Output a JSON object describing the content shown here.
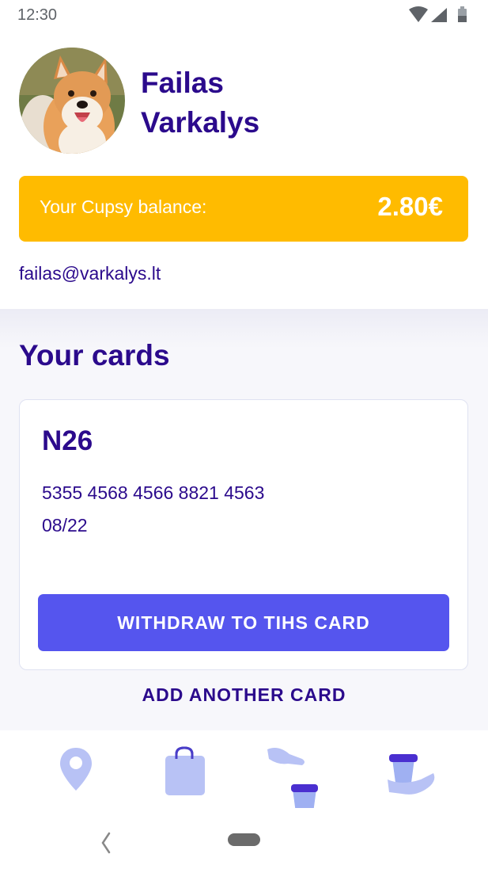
{
  "status_bar": {
    "time": "12:30",
    "icons": [
      "wifi-icon",
      "signal-icon",
      "battery-icon"
    ]
  },
  "profile": {
    "first_name": "Failas",
    "last_name": "Varkalys",
    "avatar": "shiba-inu-dog-photo",
    "balance_label": "Your Cupsy balance:",
    "balance_value": "2.80€",
    "email": "failas@varkalys.lt"
  },
  "cards": {
    "title": "Your cards",
    "items": [
      {
        "name": "N26",
        "number": "5355 4568 4566 8821 4563",
        "expiry": "08/22",
        "action": "WITHDRAW TO TIHS CARD"
      }
    ],
    "add_label": "ADD ANOTHER CARD"
  },
  "bottom_nav": {
    "items": [
      "location-pin-icon",
      "shopping-bag-icon",
      "hand-giving-cup-icon",
      "hand-holding-cup-icon"
    ]
  },
  "colors": {
    "primary_text": "#2b0a8c",
    "accent_yellow": "#ffbb00",
    "button_blue": "#5555ee",
    "icon_light_blue": "#b8c2f5"
  }
}
